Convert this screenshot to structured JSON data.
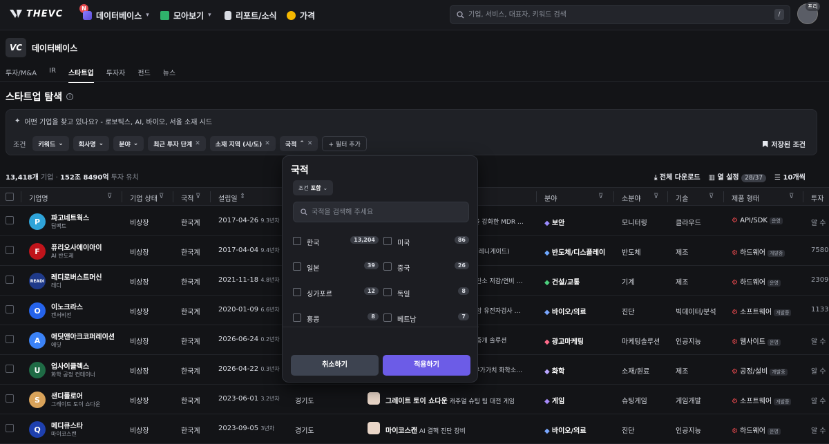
{
  "topbar": {
    "brand": "THEVC",
    "notification_badge": "N",
    "nav": [
      {
        "label": "데이터베이스",
        "icon": "database-icon"
      },
      {
        "label": "모아보기",
        "icon": "grid-icon"
      },
      {
        "label": "리포트/소식",
        "icon": "document-icon"
      },
      {
        "label": "가격",
        "icon": "coin-icon"
      }
    ],
    "search_placeholder": "기업, 서비스, 대표자, 키워드 검색",
    "search_shortcut": "/",
    "avatar_badge": "프리"
  },
  "header": {
    "logo_text": "VC",
    "title": "데이터베이스"
  },
  "tabs": [
    "투자/M&A",
    "IR",
    "스타트업",
    "투자자",
    "펀드",
    "뉴스"
  ],
  "active_tab": 2,
  "page_title": "스타트업 탐색",
  "filters": {
    "ai_prompt": "어떤 기업을 찾고 있나요? - 로보틱스, AI, 바이오, 서울 소재 시드",
    "label": "조건",
    "chips": [
      {
        "label": "키워드",
        "kind": "dropdown"
      },
      {
        "label": "회사명",
        "kind": "dropdown"
      },
      {
        "label": "분야",
        "kind": "dropdown"
      },
      {
        "label": "최근 투자 단계",
        "kind": "removable"
      },
      {
        "label": "소재 지역 (시/도)",
        "kind": "removable"
      },
      {
        "label": "국적",
        "kind": "open"
      }
    ],
    "add_filter": "+ 필터 추가",
    "saved": "저장된 조건"
  },
  "summary": {
    "count": "13,418개",
    "count_unit": "기업",
    "amount": "152조 8490억",
    "amount_unit": "투자 유치"
  },
  "toolbar": {
    "download": "전체 다운로드",
    "columns": "열 설정",
    "columns_count": "28/37",
    "rows": "10개씩"
  },
  "columns": [
    "기업명",
    "기업 상태",
    "국적",
    "설립일",
    "분야",
    "소분야",
    "기술",
    "제품 형태",
    "투자"
  ],
  "rows": [
    {
      "name": "파고네트웍스",
      "sub": "딥팩트",
      "status": "비상장",
      "nat": "한국계",
      "date": "2017-04-26",
      "age": "9.3년차",
      "region": "",
      "svc_name": "",
      "svc_desc": "능을 강화한 MDR …",
      "field": "보안",
      "subfield": "모니터링",
      "tech": "클라우드",
      "prod": "API/SDK",
      "prod_tag": "운영",
      "invest": "알 수",
      "logo_color": "#2fa4d9",
      "logo_text": "P",
      "field_color": "#9b8cff"
    },
    {
      "name": "퓨리오사에이아이",
      "sub": "AI 반도체",
      "status": "비상장",
      "nat": "한국계",
      "date": "2017-04-04",
      "age": "9.4년차",
      "region": "",
      "svc_name": "",
      "svc_desc": "서 (레니게이드)",
      "field": "반도체/디스플레이",
      "subfield": "반도체",
      "tech": "제조",
      "prod": "하드웨어",
      "prod_tag": "개발중",
      "invest": "7580",
      "logo_color": "#c0141b",
      "logo_text": "F",
      "field_color": "#6ea8ff"
    },
    {
      "name": "레디로버스트머신",
      "sub": "레디",
      "status": "비상장",
      "nat": "한국계",
      "date": "2021-11-18",
      "age": "4.8년차",
      "region": "",
      "svc_name": "",
      "svc_desc": "한 탄소 저감/연비 …",
      "field": "건설/교통",
      "subfield": "기계",
      "tech": "제조",
      "prod": "하드웨어",
      "prod_tag": "운영",
      "invest": "2309",
      "logo_color": "#1f3a8a",
      "logo_text": "READI",
      "field_color": "#4cd07d"
    },
    {
      "name": "이노크라스",
      "sub": "캔서비전",
      "status": "비상장",
      "nat": "한국계",
      "date": "2020-01-09",
      "age": "6.6년차",
      "region": "",
      "svc_name": "",
      "svc_desc": "관 암 유전자검사 …",
      "field": "바이오/의료",
      "subfield": "진단",
      "tech": "빅데이터/분석",
      "prod": "소프트웨어",
      "prod_tag": "개발중",
      "invest": "1133",
      "logo_color": "#2563eb",
      "logo_text": "O",
      "field_color": "#7aa7ff"
    },
    {
      "name": "애딧앤아크코퍼레이션",
      "sub": "애딧",
      "status": "비상장",
      "nat": "한국계",
      "date": "2026-06-24",
      "age": "0.2년차",
      "region": "",
      "svc_name": "",
      "svc_desc": "립 중개 솔루션",
      "field": "광고마케팅",
      "subfield": "마케팅솔루션",
      "tech": "인공지능",
      "prod": "웹사이트",
      "prod_tag": "운영",
      "invest": "알 수",
      "logo_color": "#3b82f6",
      "logo_text": "A",
      "field_color": "#ff6b8a"
    },
    {
      "name": "업사이클렉스",
      "sub": "화학 공정 컨테이너",
      "status": "비상장",
      "nat": "한국계",
      "date": "2026-04-22",
      "age": "0.3년차",
      "region": "",
      "svc_name": "",
      "svc_desc": "고부가가치 화학소…",
      "field": "화학",
      "subfield": "소재/원료",
      "tech": "제조",
      "prod": "공정/설비",
      "prod_tag": "개발중",
      "invest": "알 수",
      "logo_color": "#1f6b45",
      "logo_text": "U",
      "field_color": "#b9a6ff"
    },
    {
      "name": "샌디플로어",
      "sub": "그레이트 토이 쇼다운",
      "status": "비상장",
      "nat": "한국계",
      "date": "2023-06-01",
      "age": "3.2년차",
      "region": "경기도",
      "svc_name": "그레이트 토이 쇼다운",
      "svc_desc": "캐주얼 슈팅 팀 대전 게임",
      "field": "게임",
      "subfield": "슈팅게임",
      "tech": "게임개발",
      "prod": "소프트웨어",
      "prod_tag": "개발중",
      "invest": "알 수",
      "logo_color": "#d9a35a",
      "logo_text": "S",
      "field_color": "#a78bfa"
    },
    {
      "name": "메디큐스타",
      "sub": "마이코스캔",
      "status": "비상장",
      "nat": "한국계",
      "date": "2023-09-05",
      "age": "3년차",
      "region": "경기도",
      "svc_name": "마이코스캔",
      "svc_desc": "AI 결핵 진단 장비",
      "field": "바이오/의료",
      "subfield": "진단",
      "tech": "인공지능",
      "prod": "하드웨어",
      "prod_tag": "운영",
      "invest": "알 수",
      "logo_color": "#1e40af",
      "logo_text": "Q",
      "field_color": "#7aa7ff"
    }
  ],
  "dropdown": {
    "title": "국적",
    "condition_label": "조건",
    "condition_value": "포함",
    "search_placeholder": "국적을 검색해 주세요",
    "options": [
      {
        "label": "한국",
        "count": "13,204"
      },
      {
        "label": "미국",
        "count": "86"
      },
      {
        "label": "일본",
        "count": "39"
      },
      {
        "label": "중국",
        "count": "26"
      },
      {
        "label": "싱가포르",
        "count": "12"
      },
      {
        "label": "독일",
        "count": "8"
      },
      {
        "label": "홍콩",
        "count": "8"
      },
      {
        "label": "베트남",
        "count": "7"
      }
    ],
    "cancel": "취소하기",
    "apply": "적용하기"
  },
  "colors": {
    "accent": "#6c5ce7",
    "background": "#131417",
    "danger": "#e5484d"
  }
}
